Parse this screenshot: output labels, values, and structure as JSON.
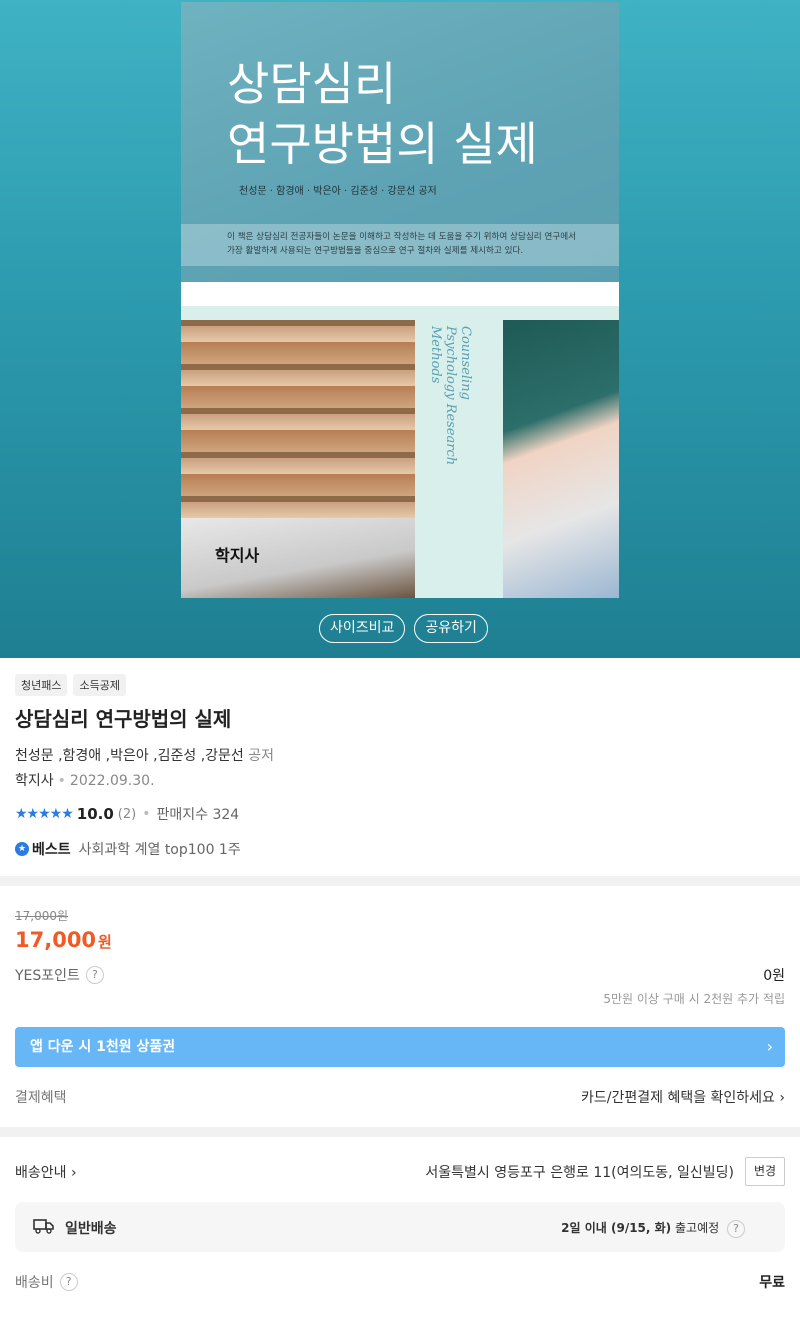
{
  "cover": {
    "title_line1": "상담심리",
    "title_line2": "연구방법의 실제",
    "authors": "천성문 · 함경애 · 박은아 · 김준성 · 강문선 공저",
    "blurb_line1": "이 책은 상담심리 전공자들이 논문을 이해하고 작성하는 데 도움을 주기 위하여 상담심리 연구에서",
    "blurb_line2": "가장 활발하게 사용되는 연구방법들을 중심으로 연구 절차와 실제를 제시하고 있다.",
    "script_text": "Counseling Psychology Research Methods",
    "publisher_logo": "학지사"
  },
  "hero_buttons": {
    "size_compare": "사이즈비교",
    "share": "공유하기"
  },
  "tags": [
    "청년패스",
    "소득공제"
  ],
  "product": {
    "title": "상담심리 연구방법의 실제",
    "authors": "천성문 ,함경애 ,박은아 ,김준성 ,강문선",
    "author_role": "공저",
    "publisher": "학지사",
    "date": "2022.09.30.",
    "stars": "★★★★★",
    "rating": "10.0",
    "review_count": "(2)",
    "sales_index": "판매지수 324",
    "best_badge": "베스트",
    "best_desc": "사회과학 계열 top100 1주"
  },
  "pricing": {
    "original_price": "17,000원",
    "price": "17,000",
    "currency": "원",
    "points_label": "YES포인트",
    "points_value": "0원",
    "points_note": "5만원 이상 구매 시 2천원 추가 적립",
    "app_banner": "앱 다운 시 1천원 상품권",
    "payment_label": "결제혜택",
    "payment_value": "카드/간편결제 혜택을 확인하세요"
  },
  "shipping": {
    "label": "배송안내",
    "address": "서울특별시 영등포구 은행로 11(여의도동, 일신빌딩)",
    "change_button": "변경",
    "type": "일반배송",
    "eta_bold": "2일 이내 (9/15, 화)",
    "eta_suffix": "출고예정",
    "fee_label": "배송비",
    "fee_value": "무료"
  },
  "colors": {
    "accent_blue": "#2b7be4",
    "price_orange": "#f05a24",
    "banner_blue": "#67b7f7",
    "hero_teal": "#2b98ac"
  }
}
